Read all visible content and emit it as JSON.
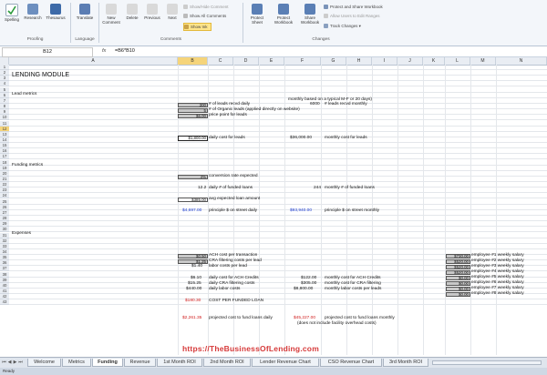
{
  "ribbon": {
    "spelling": "Spelling",
    "research": "Research",
    "thesaurus": "Thesaurus",
    "translate": "Translate",
    "new_comment": "New Comment",
    "delete": "Delete",
    "previous": "Previous",
    "next": "Next",
    "show_hide_comment": "Show/Hide Comment",
    "show_all_comments": "Show All Comments",
    "show_ink": "Show Ink",
    "protect_sheet": "Protect Sheet",
    "protect_workbook": "Protect Workbook",
    "share_workbook": "Share Workbook",
    "protect_and_share": "Protect and Share Workbook",
    "allow_users": "Allow Users to Edit Ranges",
    "track_changes": "Track Changes",
    "groups": {
      "proofing": "Proofing",
      "language": "Language",
      "comments": "Comments",
      "changes": "Changes"
    }
  },
  "formula_bar": {
    "name_box": "B12",
    "fx": "fx",
    "formula": "=B6*B10"
  },
  "columns": [
    "A",
    "B",
    "C",
    "D",
    "E",
    "F",
    "G",
    "H",
    "I",
    "J",
    "K",
    "L",
    "M",
    "N"
  ],
  "rows": [
    "1",
    "2",
    "3",
    "4",
    "5",
    "6",
    "7",
    "8",
    "9",
    "10",
    "11",
    "12",
    "13",
    "14",
    "15",
    "16",
    "17",
    "18",
    "19",
    "20",
    "21",
    "22",
    "23",
    "24",
    "25",
    "26",
    "27",
    "28",
    "29",
    "30",
    "31",
    "32",
    "33",
    "34",
    "35",
    "36",
    "37",
    "38",
    "39",
    "40",
    "41",
    "42",
    "43"
  ],
  "sheet": {
    "title": "LENDING MODULE",
    "lead_metrics": "Lead metrics",
    "monthly_note": "monthly based on a typical M-F or 20 days)",
    "b6": "300",
    "b6_label": "# of leads recvd daily",
    "f6": "6000",
    "f6_label": "# leads recvd monthly",
    "b7": "5",
    "b7_label": "# of Organic leads (applied directly on website)",
    "b8": "$6.00",
    "b8_label": "price point for leads",
    "b12": "$1,800.00",
    "b12_label": "daily cost for leads",
    "f12": "$36,000.00",
    "f12_label": "monthly cost for leads",
    "funding_metrics": "Funding metrics",
    "b18": "4%",
    "b18_label": "conversion rate expected",
    "b20": "12.2",
    "b20_label": "daily # of funded loans",
    "f20": "244",
    "f20_label": "monthly # of funded loans",
    "b22": "$385.00",
    "b22_label": "avg expected loan amount",
    "b24": "$4,697.00",
    "b24_label": "principle $ on street daily",
    "f24": "$93,940.00",
    "f24_label": "principle $ on street monthly",
    "expenses": "Expenses",
    "b28": "$0.50",
    "b28_label": "ACH cost per transaction",
    "b29": "$1.25",
    "b29_label": "CRA filtering costs per lead",
    "b30": "$1.40",
    "b30_label": "labor costs per lead",
    "b32": "$6.10",
    "b32_label": "daily cost for ACH Credits",
    "f32": "$122.00",
    "f32_label": "monthly cost for ACH Credits",
    "b33": "$15.25",
    "b33_label": "daily CRA filtering costs",
    "f33": "$305.00",
    "f33_label": "monthly cost for CRA filtering",
    "b34": "$440.00",
    "b34_label": "daily labor costs",
    "f34": "$8,800.00",
    "f34_label": "monthly labor costs per leads",
    "b36": "$180.30",
    "b36_label": "COST PER FUNDED LOAN",
    "b39": "$2,261.35",
    "b39_label": "projected cost to fund loans daily",
    "f39": "$45,227.00",
    "f39_label": "projected cost to fund loans monthly",
    "f40_note": "(does not include facility overhead costs)",
    "salaries": [
      {
        "value": "$730.00",
        "label": "employee #1 weekly salary"
      },
      {
        "value": "$520.00",
        "label": "employee #2 weekly salary"
      },
      {
        "value": "$520.00",
        "label": "employee #3 weekly salary"
      },
      {
        "value": "$520.00",
        "label": "employee #4 weekly salary"
      },
      {
        "value": "$0.00",
        "label": "employee #5 weekly salary"
      },
      {
        "value": "$0.00",
        "label": "employee #6 weekly salary"
      },
      {
        "value": "$0.00",
        "label": "employee #7 weekly salary"
      },
      {
        "value": "$0.00",
        "label": "employee #8 weekly salary"
      }
    ]
  },
  "tabs": [
    "Welcome",
    "Metrics",
    "Funding",
    "Revenue",
    "1st Month ROI",
    "2nd Month ROI",
    "Lender Revenue Chart",
    "CSO Revenue Chart",
    "3rd Month ROI"
  ],
  "active_tab": "Funding",
  "status": "Ready",
  "watermark": "https://TheBusinessOfLending.com",
  "colors": {
    "accent_select": "#f5d47a",
    "blue_text": "#1f3fd0",
    "red_text": "#d12020",
    "watermark": "#d63a3a"
  }
}
